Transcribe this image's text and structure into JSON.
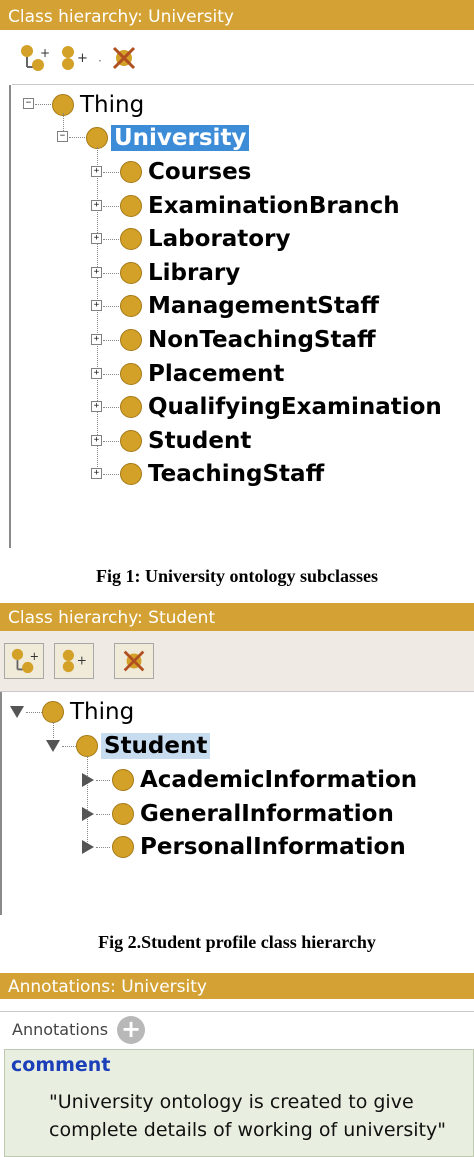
{
  "panel1": {
    "title": "Class hierarchy: University",
    "toolbar": [
      "add-subclass-icon",
      "add-sibling-icon",
      "delete-class-icon"
    ],
    "root": "Thing",
    "selected": "University",
    "children": [
      "Courses",
      "ExaminationBranch",
      "Laboratory",
      "Library",
      "ManagementStaff",
      "NonTeachingStaff",
      "Placement",
      "QualifyingExamination",
      "Student",
      "TeachingStaff"
    ]
  },
  "caption1": "Fig 1: University ontology subclasses",
  "panel2": {
    "title": "Class hierarchy: Student",
    "toolbar": [
      "add-subclass-icon",
      "add-sibling-icon",
      "delete-class-icon"
    ],
    "root": "Thing",
    "selected": "Student",
    "children": [
      "AcademicInformation",
      "GeneralInformation",
      "PersonalInformation"
    ]
  },
  "caption2": "Fig 2.Student profile class hierarchy",
  "panel3": {
    "title": "Annotations: University",
    "header": "Annotations",
    "property": "comment",
    "value_line1": "\"University ontology is created to give",
    "value_line2": "complete details of working of university\""
  },
  "colors": {
    "titlebar": "#d4a234",
    "class_dot": "#d4a128",
    "selection_primary": "#3d8cd8",
    "selection_secondary": "#c8dcf0",
    "comment_label": "#1a3fb8"
  }
}
